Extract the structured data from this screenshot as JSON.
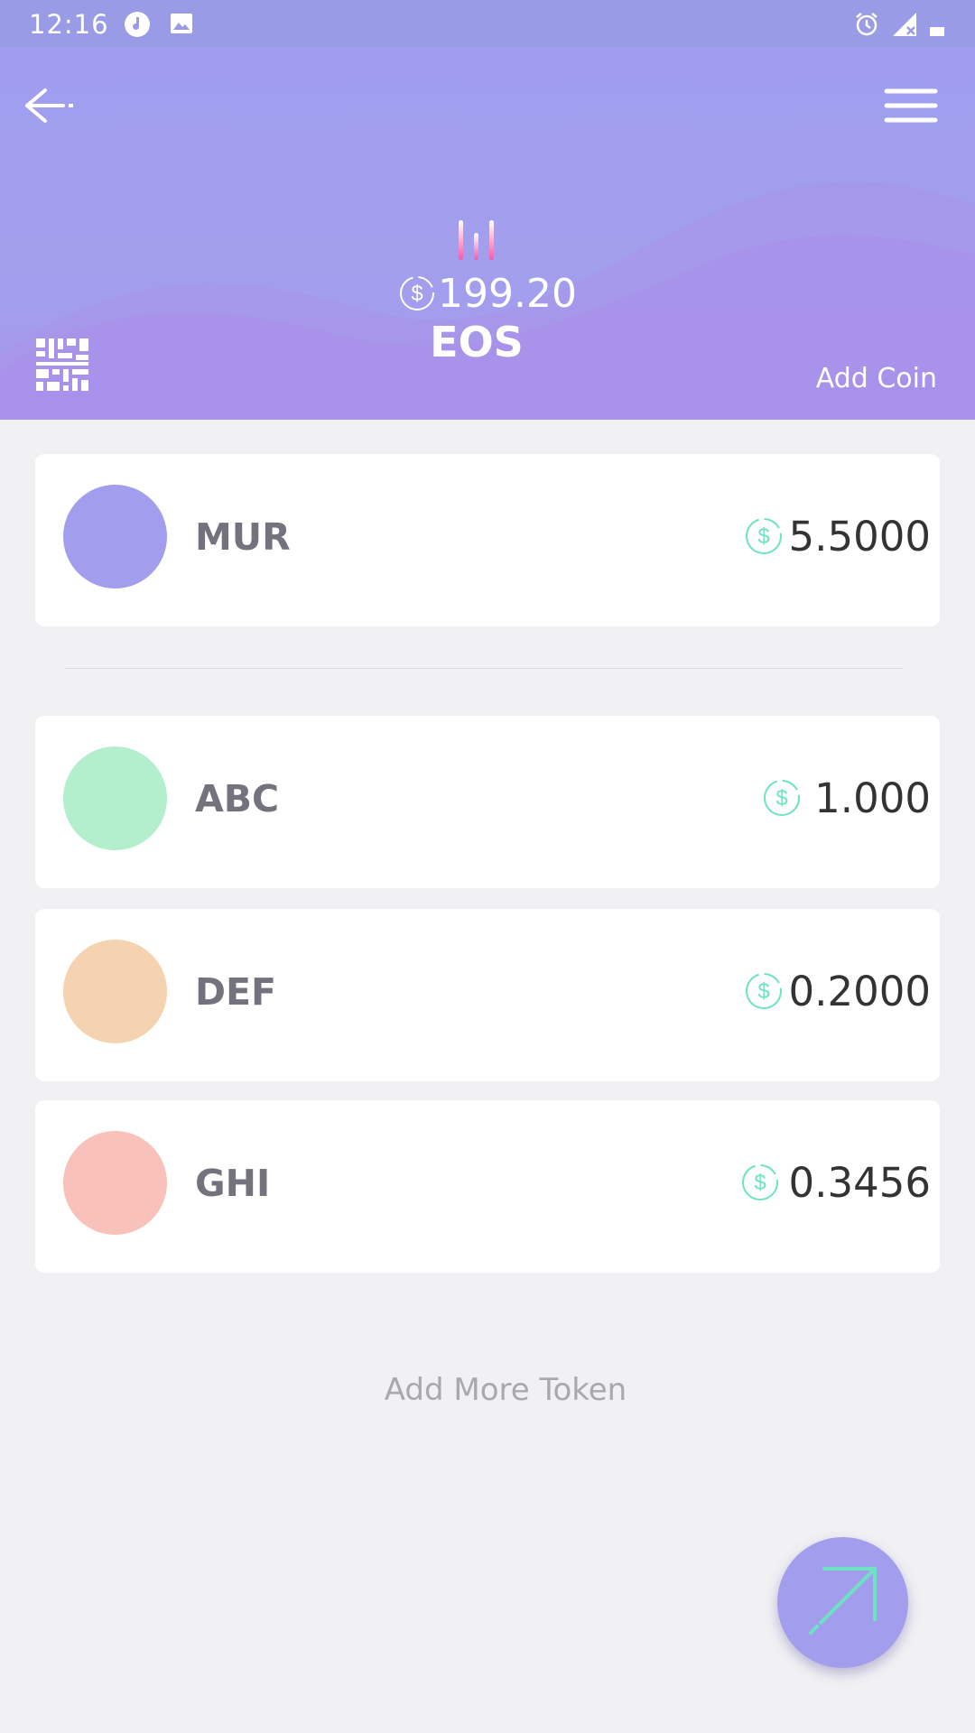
{
  "status_bar": {
    "time": "12:16",
    "left_icons": [
      "music-note-icon",
      "image-icon"
    ],
    "right_icons": [
      "alarm-icon",
      "signal-icon",
      "battery-icon"
    ]
  },
  "header": {
    "back_icon": "arrow-left-icon",
    "menu_icon": "hamburger-menu-icon",
    "chart_icon": "bar-chart-icon",
    "balance": "199.20",
    "symbol": "EOS",
    "qr_icon": "qr-code-icon",
    "add_coin_label": "Add Coin"
  },
  "tokens": [
    {
      "symbol": "MUR",
      "amount": "5.5000",
      "color": "#a29eed"
    },
    {
      "symbol": "ABC",
      "amount": "1.000",
      "color": "#b3eecd"
    },
    {
      "symbol": "DEF",
      "amount": "0.2000",
      "color": "#f6d3b0"
    },
    {
      "symbol": "GHI",
      "amount": "0.3456",
      "color": "#f8c2bb"
    }
  ],
  "add_more_label": "Add More Token",
  "fab": {
    "icon": "send-arrow-icon"
  },
  "colors": {
    "header": "#a29fed",
    "accent": "#6ce3c3",
    "background": "#f1f1f4"
  }
}
